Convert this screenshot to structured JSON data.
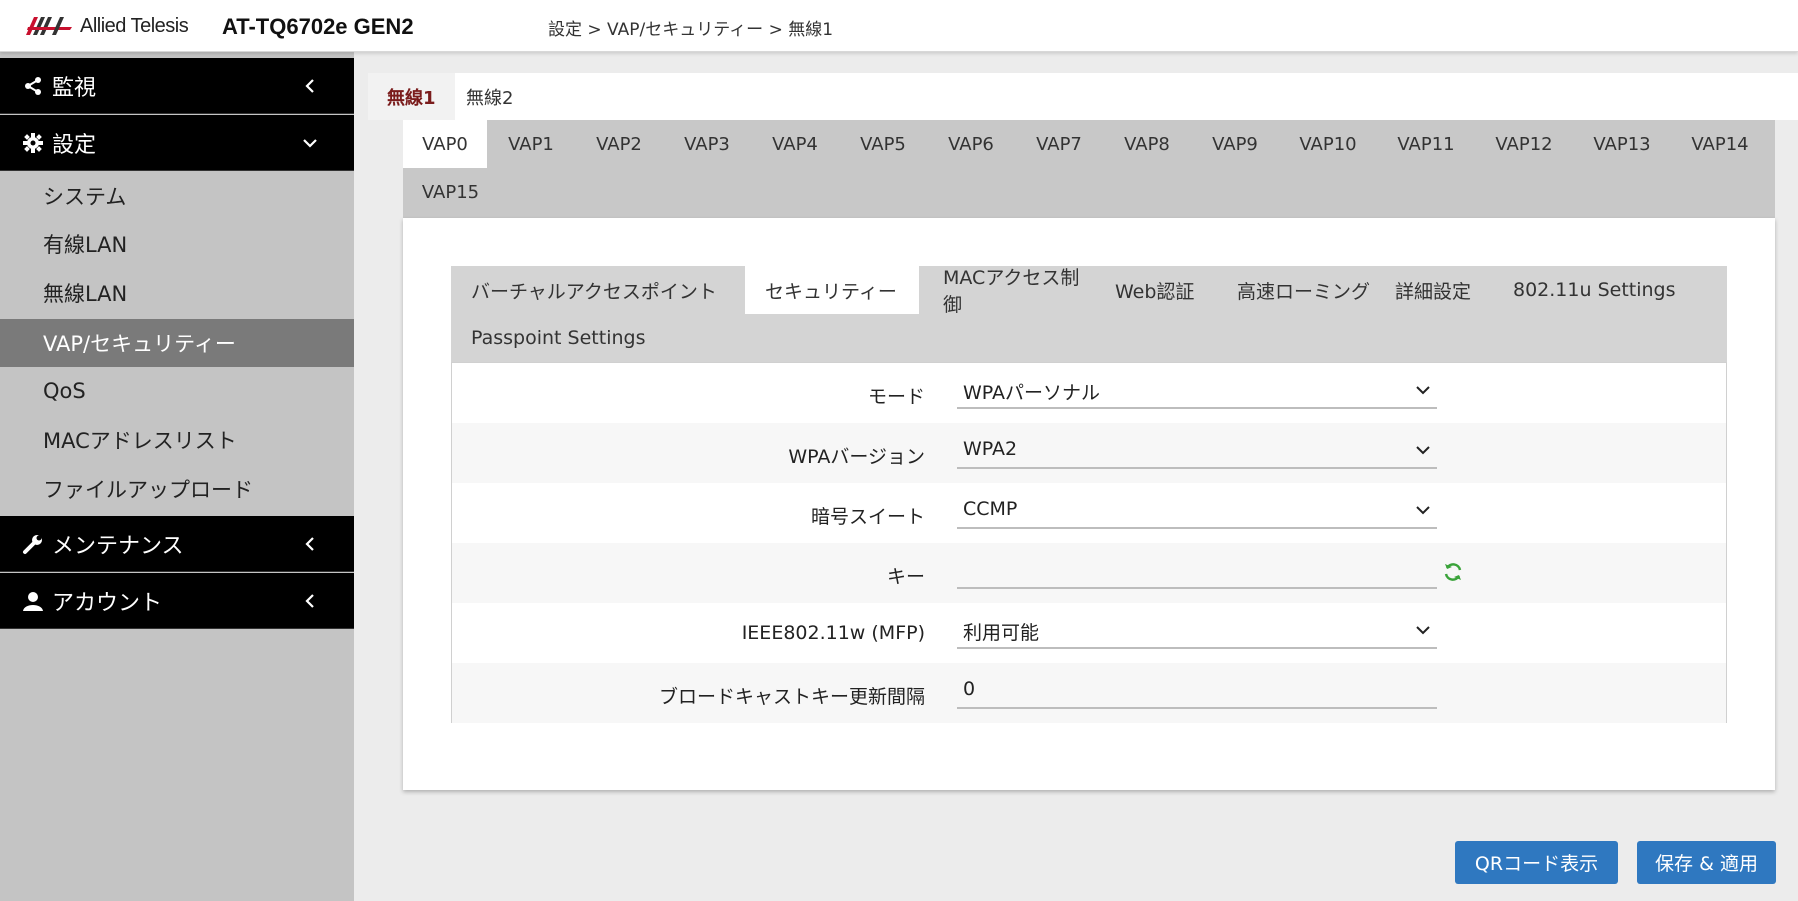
{
  "header": {
    "logo_text": "Allied Telesis",
    "model": "AT-TQ6702e GEN2",
    "breadcrumb": "設定 > VAP/セキュリティー > 無線1"
  },
  "sidebar": {
    "top_items": [
      {
        "label": "監視",
        "icon": "share-icon"
      },
      {
        "label": "設定",
        "icon": "gear-icon"
      },
      {
        "label": "メンテナンス",
        "icon": "wrench-icon"
      },
      {
        "label": "アカウント",
        "icon": "user-icon"
      }
    ],
    "settings_items": [
      {
        "label": "システム"
      },
      {
        "label": "有線LAN"
      },
      {
        "label": "無線LAN"
      },
      {
        "label": "VAP/セキュリティー"
      },
      {
        "label": "QoS"
      },
      {
        "label": "MACアドレスリスト"
      },
      {
        "label": "ファイルアップロード"
      }
    ],
    "active_item": "VAP/セキュリティー"
  },
  "radio_tabs": [
    {
      "label": "無線1"
    },
    {
      "label": "無線2"
    }
  ],
  "vap_tabs": [
    {
      "label": "VAP0"
    },
    {
      "label": "VAP1"
    },
    {
      "label": "VAP2"
    },
    {
      "label": "VAP3"
    },
    {
      "label": "VAP4"
    },
    {
      "label": "VAP5"
    },
    {
      "label": "VAP6"
    },
    {
      "label": "VAP7"
    },
    {
      "label": "VAP8"
    },
    {
      "label": "VAP9"
    },
    {
      "label": "VAP10"
    },
    {
      "label": "VAP11"
    },
    {
      "label": "VAP12"
    },
    {
      "label": "VAP13"
    },
    {
      "label": "VAP14"
    },
    {
      "label": "VAP15"
    }
  ],
  "sub_tabs": [
    {
      "label": "バーチャルアクセスポイント"
    },
    {
      "label": "セキュリティー"
    },
    {
      "label": "MACアクセス制御"
    },
    {
      "label": "Web認証"
    },
    {
      "label": "高速ローミング"
    },
    {
      "label": "詳細設定"
    },
    {
      "label": "802.11u Settings"
    },
    {
      "label": "Passpoint Settings"
    }
  ],
  "form": {
    "rows": [
      {
        "label": "モード",
        "value": "WPAパーソナル",
        "type": "select"
      },
      {
        "label": "WPAバージョン",
        "value": "WPA2",
        "type": "select"
      },
      {
        "label": "暗号スイート",
        "value": "CCMP",
        "type": "select"
      },
      {
        "label": "キー",
        "value": "",
        "type": "text"
      },
      {
        "label": "IEEE802.11w (MFP)",
        "value": "利用可能",
        "type": "select"
      },
      {
        "label": "ブロードキャストキー更新間隔",
        "value": "0",
        "type": "text"
      }
    ]
  },
  "buttons": {
    "qr": "QRコード表示",
    "save": "保存 & 適用"
  },
  "colors": {
    "sidebar_bg": "#c4c4c4",
    "menu_black": "#000000",
    "active_item_bg": "#7a7a7a",
    "button_blue": "#2f78c0",
    "active_radio_tab_text": "#7a1c1c",
    "refresh_icon_green": "#3aa33a"
  }
}
